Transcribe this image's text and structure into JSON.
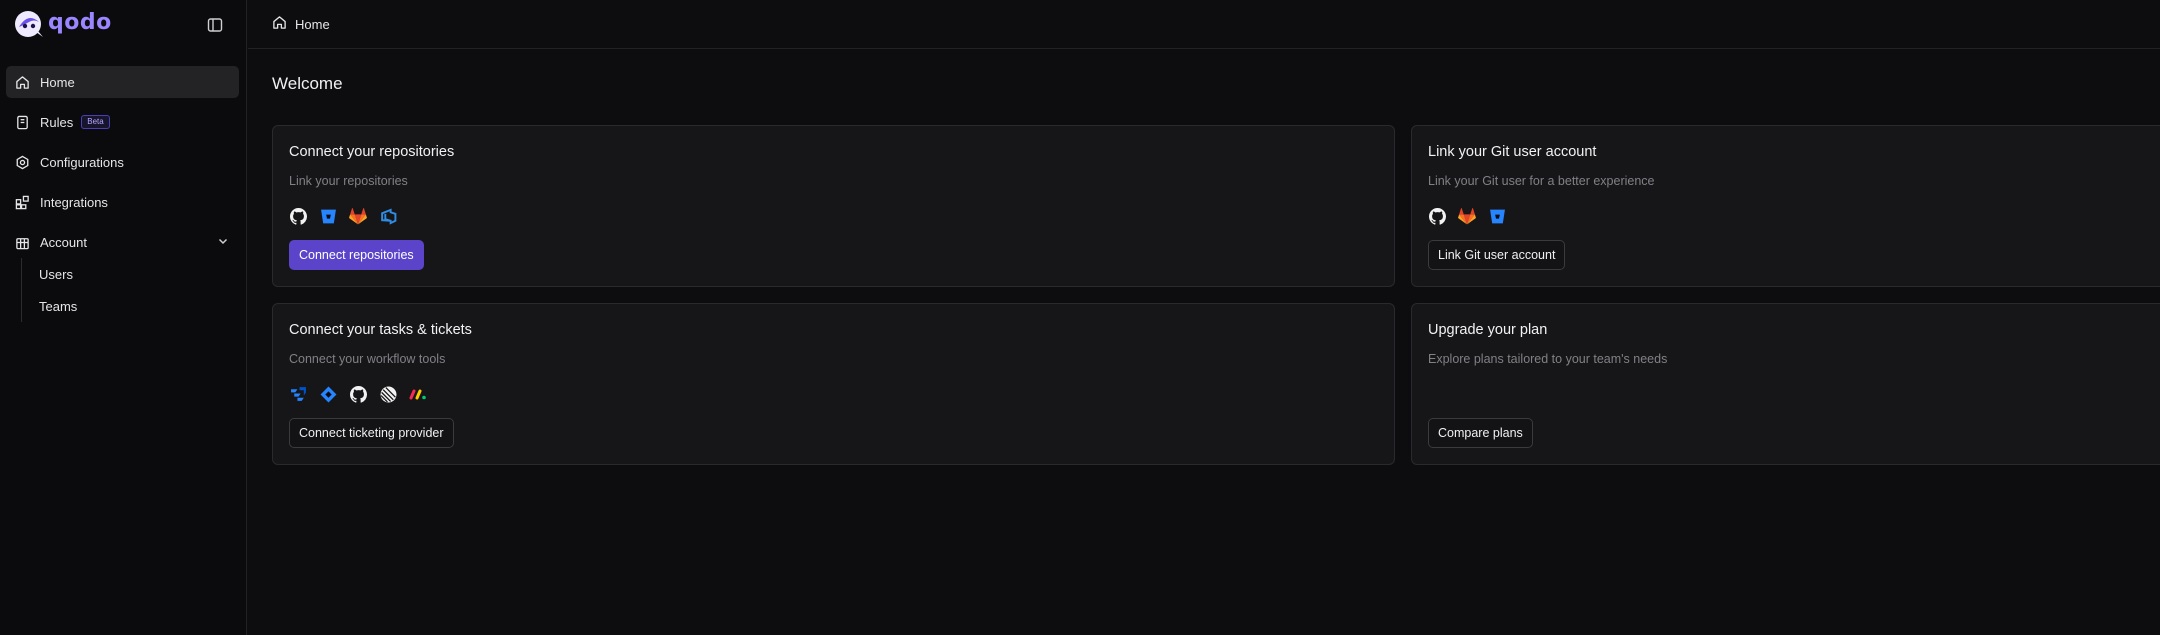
{
  "app": {
    "brand": "qodo",
    "accent": "#5b44c9",
    "brand_color": "#9a86ff"
  },
  "sidebar": {
    "items": [
      {
        "label": "Home",
        "icon": "home-icon",
        "active": true
      },
      {
        "label": "Rules",
        "icon": "rules-icon",
        "badge": "Beta"
      },
      {
        "label": "Configurations",
        "icon": "settings-icon"
      },
      {
        "label": "Integrations",
        "icon": "integrations-icon"
      },
      {
        "label": "Account",
        "icon": "building-icon",
        "expanded": true
      }
    ],
    "account_children": [
      "Users",
      "Teams"
    ]
  },
  "breadcrumb": {
    "label": "Home",
    "icon": "home-icon"
  },
  "main": {
    "title": "Welcome",
    "cards": [
      {
        "title": "Connect your repositories",
        "subtitle": "Link your repositories",
        "icons": [
          "github-icon",
          "bitbucket-icon",
          "gitlab-icon",
          "azure-devops-icon"
        ],
        "button": "Connect repositories"
      },
      {
        "title": "Link your Git user account",
        "subtitle": "Link your Git user for a better experience",
        "icons": [
          "github-icon",
          "gitlab-icon",
          "bitbucket-icon"
        ],
        "button": "Link Git user account"
      },
      {
        "title": "Connect your tasks & tickets",
        "subtitle": "Connect your workflow tools",
        "icons": [
          "jira-icon",
          "jira-diamond-icon",
          "github-icon",
          "linear-icon",
          "monday-icon"
        ],
        "button": "Connect ticketing provider"
      },
      {
        "title": "Upgrade your plan",
        "subtitle": "Explore plans tailored to your team's needs",
        "icons": [],
        "button": "Compare plans"
      }
    ]
  }
}
